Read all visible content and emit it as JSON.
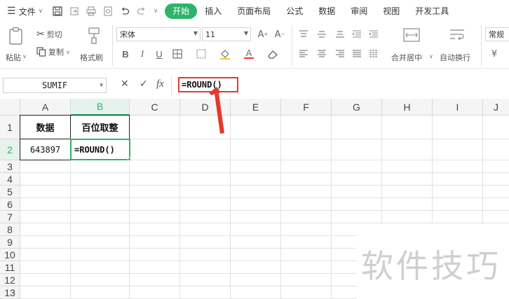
{
  "menubar": {
    "file_label": "文件",
    "tabs": [
      "开始",
      "插入",
      "页面布局",
      "公式",
      "数据",
      "审阅",
      "视图",
      "开发工具"
    ],
    "active_tab": "开始"
  },
  "ribbon": {
    "paste_label": "粘贴",
    "cut_label": "剪切",
    "copy_label": "复制",
    "format_painter_label": "格式刷",
    "font_name": "宋体",
    "font_size": "11",
    "bold": "B",
    "italic": "I",
    "underline": "U",
    "merge_label": "合并居中",
    "wrap_label": "自动换行",
    "number_format": "常规",
    "currency_symbol": "¥"
  },
  "formula_bar": {
    "name_box": "SUMIF",
    "cancel": "✕",
    "confirm": "✓",
    "fx": "fx",
    "formula": "=ROUND()"
  },
  "grid": {
    "columns": [
      "A",
      "B",
      "C",
      "D",
      "E",
      "F",
      "G",
      "H",
      "I",
      "J"
    ],
    "rows": [
      "1",
      "2",
      "3",
      "4",
      "5",
      "6",
      "7",
      "8",
      "9",
      "10",
      "11",
      "12",
      "13"
    ],
    "selected_column": "B",
    "selected_row": "2",
    "cells": {
      "A1": "数据",
      "B1": "百位取整",
      "A2": "643897",
      "B2": "=ROUND()"
    }
  },
  "annotation": {
    "highlight_color": "#e23a2e",
    "accent_color": "#2db36a"
  },
  "watermark": "软件技巧"
}
